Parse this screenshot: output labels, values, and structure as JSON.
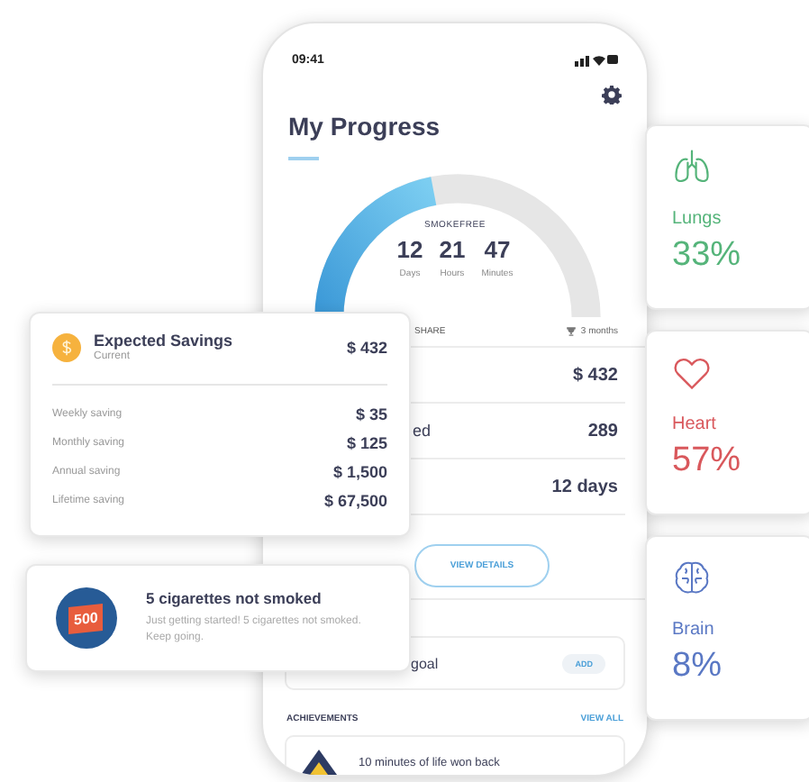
{
  "phone": {
    "status_time": "09:41",
    "title": "My Progress",
    "counter": {
      "label": "SMOKEFREE",
      "level": 0.44,
      "units": [
        {
          "value": "12",
          "label": "Days"
        },
        {
          "value": "21",
          "label": "Hours"
        },
        {
          "value": "47",
          "label": "Minutes"
        }
      ]
    },
    "share": {
      "label": "SHARE",
      "period": "3 months"
    },
    "stats": [
      {
        "value": "$ 432"
      },
      {
        "label": "ed",
        "value": "289"
      },
      {
        "value": "12 days"
      }
    ],
    "details_button": "VIEW DETAILS",
    "goal": {
      "label": "goal",
      "button": "ADD"
    },
    "achievements": {
      "heading": "ACHIEVEMENTS",
      "link": "VIEW ALL",
      "items": [
        {
          "text": "10 minutes of life won back"
        }
      ]
    }
  },
  "savings": {
    "title": "Expected Savings",
    "subtitle": "Current",
    "total": "$ 432",
    "rows": [
      {
        "label": "Weekly saving",
        "value": "$ 35"
      },
      {
        "label": "Monthly saving",
        "value": "$ 125"
      },
      {
        "label": "Annual saving",
        "value": "$ 1,500"
      },
      {
        "label": "Lifetime saving",
        "value": "$ 67,500"
      }
    ]
  },
  "milestone": {
    "badge": "500",
    "title": "5 cigarettes not smoked",
    "text": "Just getting started! 5 cigarettes not smoked. Keep going."
  },
  "organs": [
    {
      "kind": "lungs",
      "name": "Lungs",
      "percent": "33%",
      "color": "#55b47a"
    },
    {
      "kind": "heart",
      "name": "Heart",
      "percent": "57%",
      "color": "#d9585c"
    },
    {
      "kind": "brain",
      "name": "Brain",
      "percent": "8%",
      "color": "#5a78c4"
    }
  ]
}
